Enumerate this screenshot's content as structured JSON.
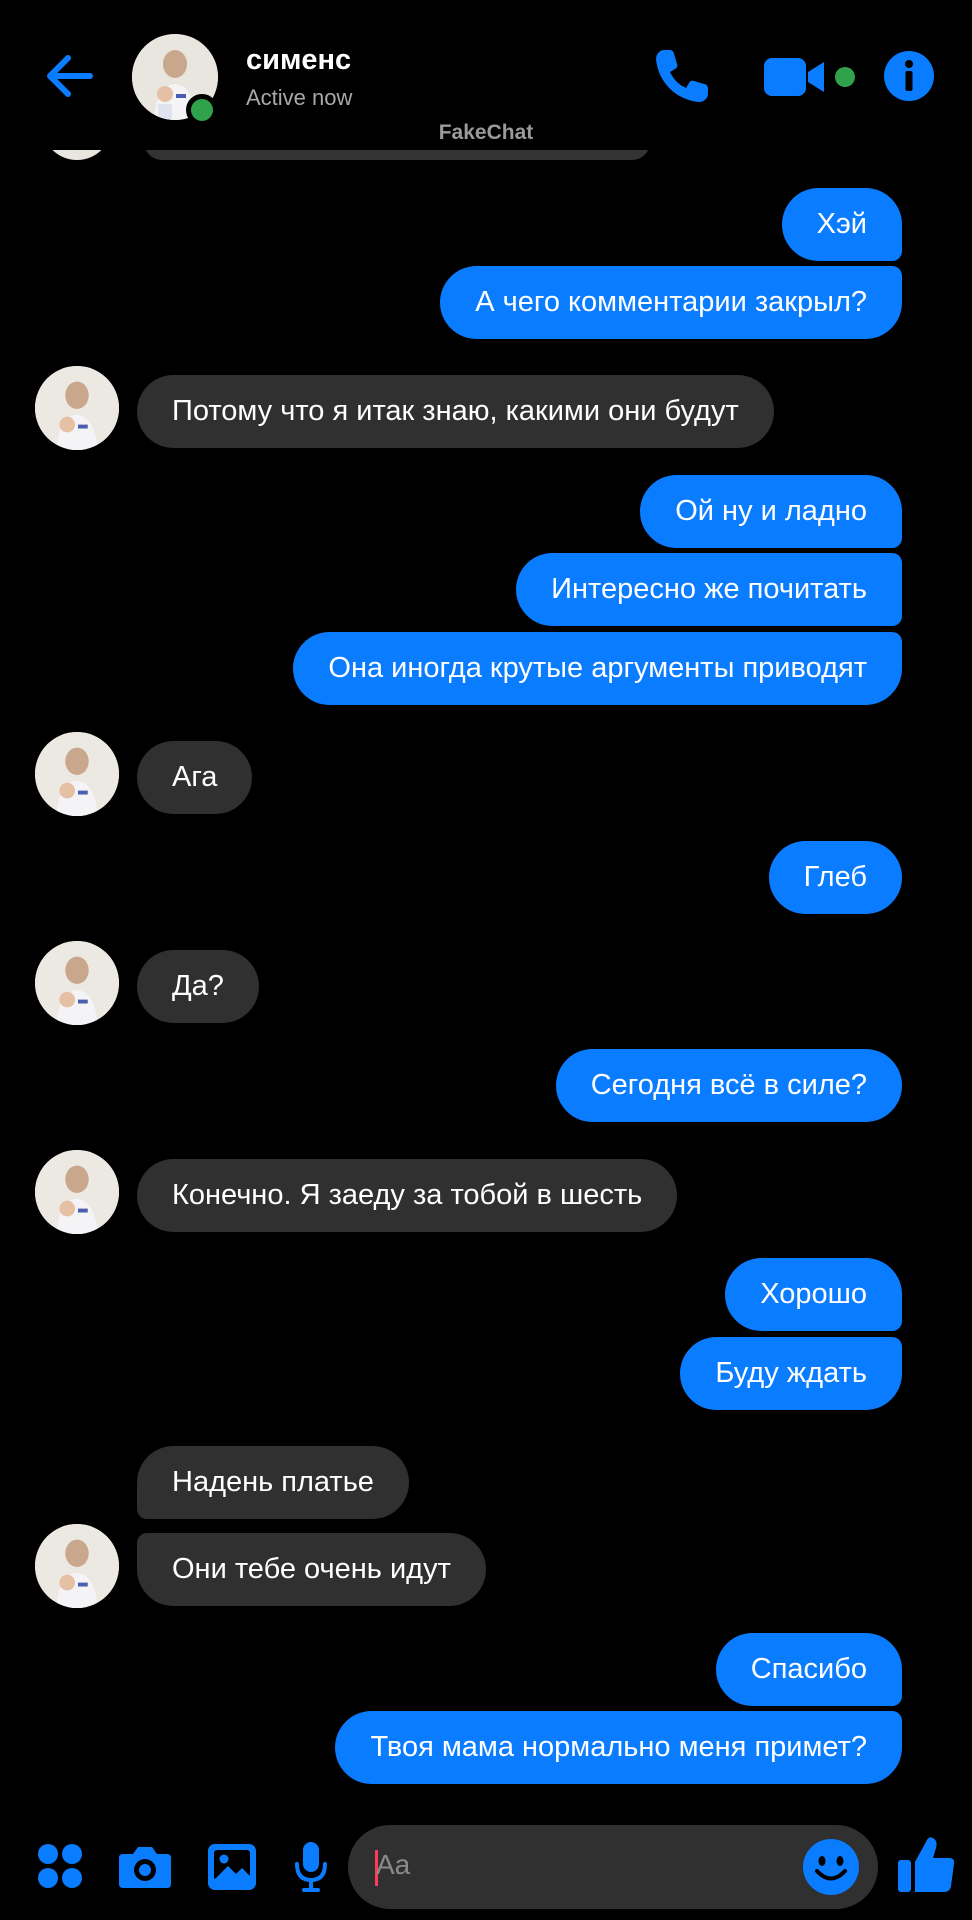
{
  "header": {
    "contact_name": "сименс",
    "status": "Active now",
    "watermark": "FakeChat",
    "icons": [
      "back-arrow-icon",
      "phone-icon",
      "video-camera-icon",
      "info-icon"
    ]
  },
  "messages": [
    {
      "side": "out",
      "text": "Хэй"
    },
    {
      "side": "out",
      "text": "А чего комментарии закрыл?"
    },
    {
      "side": "in",
      "text": "Потому что я итак знаю, какими они будут"
    },
    {
      "side": "out",
      "text": "Ой ну и ладно"
    },
    {
      "side": "out",
      "text": "Интересно же почитать"
    },
    {
      "side": "out",
      "text": "Она иногда крутые аргументы приводят"
    },
    {
      "side": "in",
      "text": "Ага"
    },
    {
      "side": "out",
      "text": "Глеб"
    },
    {
      "side": "in",
      "text": "Да?"
    },
    {
      "side": "out",
      "text": "Сегодня всё в силе?"
    },
    {
      "side": "in",
      "text": "Конечно.  Я заеду за тобой в шесть"
    },
    {
      "side": "out",
      "text": "Хорошо"
    },
    {
      "side": "out",
      "text": "Буду ждать"
    },
    {
      "side": "in",
      "text": "Надень платье"
    },
    {
      "side": "in",
      "text": "Они тебе очень идут"
    },
    {
      "side": "out",
      "text": "Спасибо"
    },
    {
      "side": "out",
      "text": "Твоя мама нормально меня примет?"
    }
  ],
  "composer": {
    "placeholder": "Aa",
    "icons": [
      "apps-grid-icon",
      "camera-icon",
      "gallery-icon",
      "microphone-icon",
      "emoji-icon",
      "thumbs-up-icon"
    ]
  },
  "colors": {
    "outgoing_bubble": "#0a7cff",
    "incoming_bubble": "#303030",
    "accent": "#0a7cff",
    "online": "#31a24c",
    "background": "#000000"
  }
}
